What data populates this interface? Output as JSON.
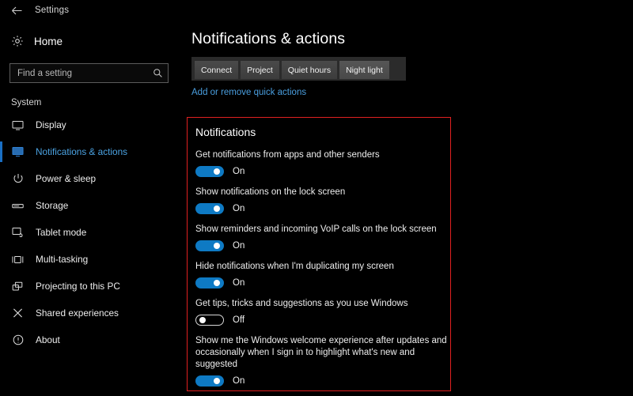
{
  "titlebar": {
    "back_icon": "back-arrow-icon",
    "title": "Settings"
  },
  "sidebar": {
    "home": {
      "icon": "gear-icon",
      "label": "Home"
    },
    "search": {
      "icon": "search-icon",
      "placeholder": "Find a setting",
      "value": ""
    },
    "group_title": "System",
    "items": [
      {
        "icon": "monitor-icon",
        "label": "Display",
        "selected": false
      },
      {
        "icon": "notification-icon",
        "label": "Notifications & actions",
        "selected": true
      },
      {
        "icon": "power-icon",
        "label": "Power & sleep",
        "selected": false
      },
      {
        "icon": "storage-icon",
        "label": "Storage",
        "selected": false
      },
      {
        "icon": "tablet-icon",
        "label": "Tablet mode",
        "selected": false
      },
      {
        "icon": "multitasking-icon",
        "label": "Multi-tasking",
        "selected": false
      },
      {
        "icon": "projecting-icon",
        "label": "Projecting to this PC",
        "selected": false
      },
      {
        "icon": "shared-experiences-icon",
        "label": "Shared experiences",
        "selected": false
      },
      {
        "icon": "info-icon",
        "label": "About",
        "selected": false
      }
    ]
  },
  "main": {
    "page_title": "Notifications & actions",
    "quick_actions": [
      {
        "label": "Connect",
        "highlight": false
      },
      {
        "label": "Project",
        "highlight": false
      },
      {
        "label": "Quiet hours",
        "highlight": false
      },
      {
        "label": "Night light",
        "highlight": true
      }
    ],
    "quick_actions_link": "Add or remove quick actions",
    "notifications": {
      "section_title": "Notifications",
      "highlight_color": "#e02020",
      "accent_color": "#0e7ac4",
      "settings": [
        {
          "label": "Get notifications from apps and other senders",
          "state": "On",
          "on": true
        },
        {
          "label": "Show notifications on the lock screen",
          "state": "On",
          "on": true
        },
        {
          "label": "Show reminders and incoming VoIP calls on the lock screen",
          "state": "On",
          "on": true
        },
        {
          "label": "Hide notifications when I'm duplicating my screen",
          "state": "On",
          "on": true
        },
        {
          "label": "Get tips, tricks and suggestions as you use Windows",
          "state": "Off",
          "on": false
        },
        {
          "label": "Show me the Windows welcome experience after updates and occasionally when I sign in to highlight what's new and suggested",
          "state": "On",
          "on": true
        }
      ]
    }
  }
}
